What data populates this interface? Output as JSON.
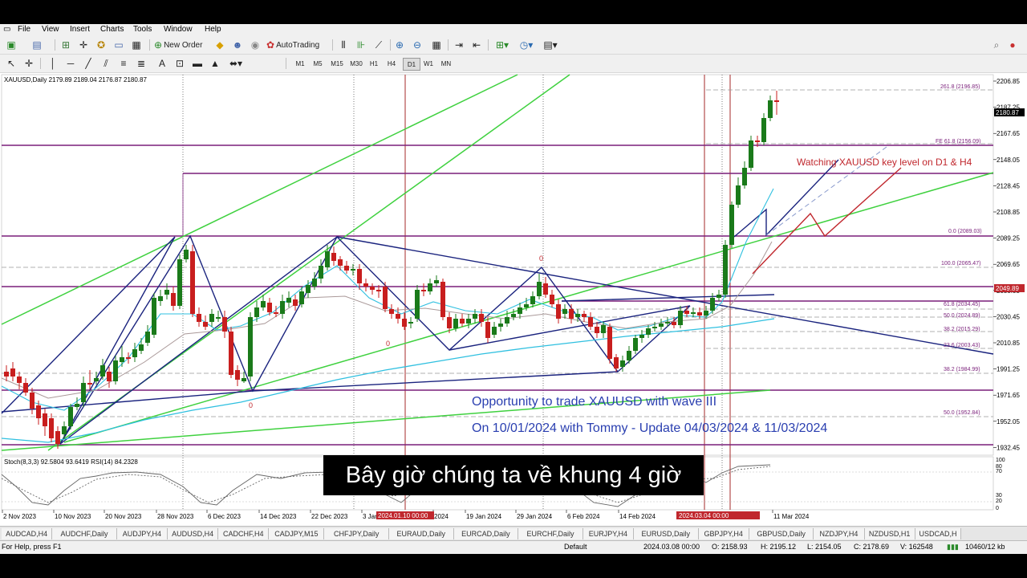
{
  "menu": [
    "File",
    "View",
    "Insert",
    "Charts",
    "Tools",
    "Window",
    "Help"
  ],
  "toolbar": {
    "new_order": "New Order",
    "autotrading": "AutoTrading",
    "timeframes": [
      "M1",
      "M5",
      "M15",
      "M30",
      "H1",
      "H4",
      "D1",
      "W1",
      "MN"
    ]
  },
  "chart": {
    "header": "XAUUSD,Daily  2179.89 2189.04 2176.87 2180.87",
    "current_price": "2180.87",
    "marker_price": "2049.89",
    "price_ticks": [
      "2206.85",
      "2187.25",
      "2167.65",
      "2148.05",
      "2128.45",
      "2108.85",
      "2089.25",
      "2069.65",
      "2050.05",
      "2030.45",
      "2010.85",
      "1991.25",
      "1971.65",
      "1952.05",
      "1932.45"
    ],
    "fib_labels": [
      "261.8 (2196.85)",
      "FE 61.8 (2156.09)",
      "0.0 (2089.03)",
      "100.0 (2065.47)",
      "61.8 (2034.45)",
      "50.0 (2024.89)",
      "38.2 (2015.29)",
      "23.6 (2003.43)",
      "38.2 (1984.99)",
      "50.0 (1952.84)"
    ],
    "date_labels": [
      "2 Nov 2023",
      "10 Nov 2023",
      "20 Nov 2023",
      "28 Nov 2023",
      "6 Dec 2023",
      "14 Dec 2023",
      "22 Dec 2023",
      "3 Jan 2024",
      "2024",
      "19 Jan 2024",
      "29 Jan 2024",
      "6 Feb 2024",
      "14 Feb 2024",
      "11 Mar 2024"
    ],
    "date_highlights": [
      "2024.01.10 00:00",
      "2024.03.04 00:00"
    ],
    "annotation_watch": "Watching XAUUSD key level on D1 & H4",
    "annotation_line1": "Opportunity to trade XAUUSD with wave III",
    "annotation_line2": "On 10/01/2024 with Tommy - Update 04/03/2024 & 11/03/2024",
    "wave_labels": [
      "0",
      "0",
      "0"
    ],
    "indicator_header": "Stoch(8,3,3) 92.5804 93.6419  RSI(14) 84.2328",
    "indicator_ticks": [
      "100",
      "80",
      "70",
      "30",
      "20",
      "0"
    ],
    "colors": {
      "bull": "#1a7a1a",
      "bear": "#c81e1e",
      "purple": "#7a1f7a",
      "green_line": "#3fd13f",
      "navy": "#1a237e",
      "cyan": "#30c0e0",
      "red_text": "#c0272d",
      "blue_text": "#2a3fb0"
    }
  },
  "tabs": [
    "AUDCAD,H4",
    "AUDCHF,Daily",
    "AUDJPY,H4",
    "AUDUSD,H4",
    "CADCHF,H4",
    "CADJPY,M15",
    "CHFJPY,Daily",
    "EURAUD,Daily",
    "EURCAD,Daily",
    "EURCHF,Daily",
    "EURJPY,H4",
    "EURUSD,Daily",
    "GBPJPY,H4",
    "GBPUSD,Daily",
    "NZDJPY,H4",
    "NZDUSD,H1",
    "USDCAD,H"
  ],
  "status": {
    "help": "For Help, press F1",
    "profile": "Default",
    "datetime": "2024.03.08 00:00",
    "open": "O: 2158.93",
    "high": "H: 2195.12",
    "low": "L: 2154.05",
    "close": "C: 2178.69",
    "volume": "V: 162548",
    "traffic": "10460/12 kb"
  },
  "subtitle": "Bây giờ chúng ta về khung 4 giờ"
}
